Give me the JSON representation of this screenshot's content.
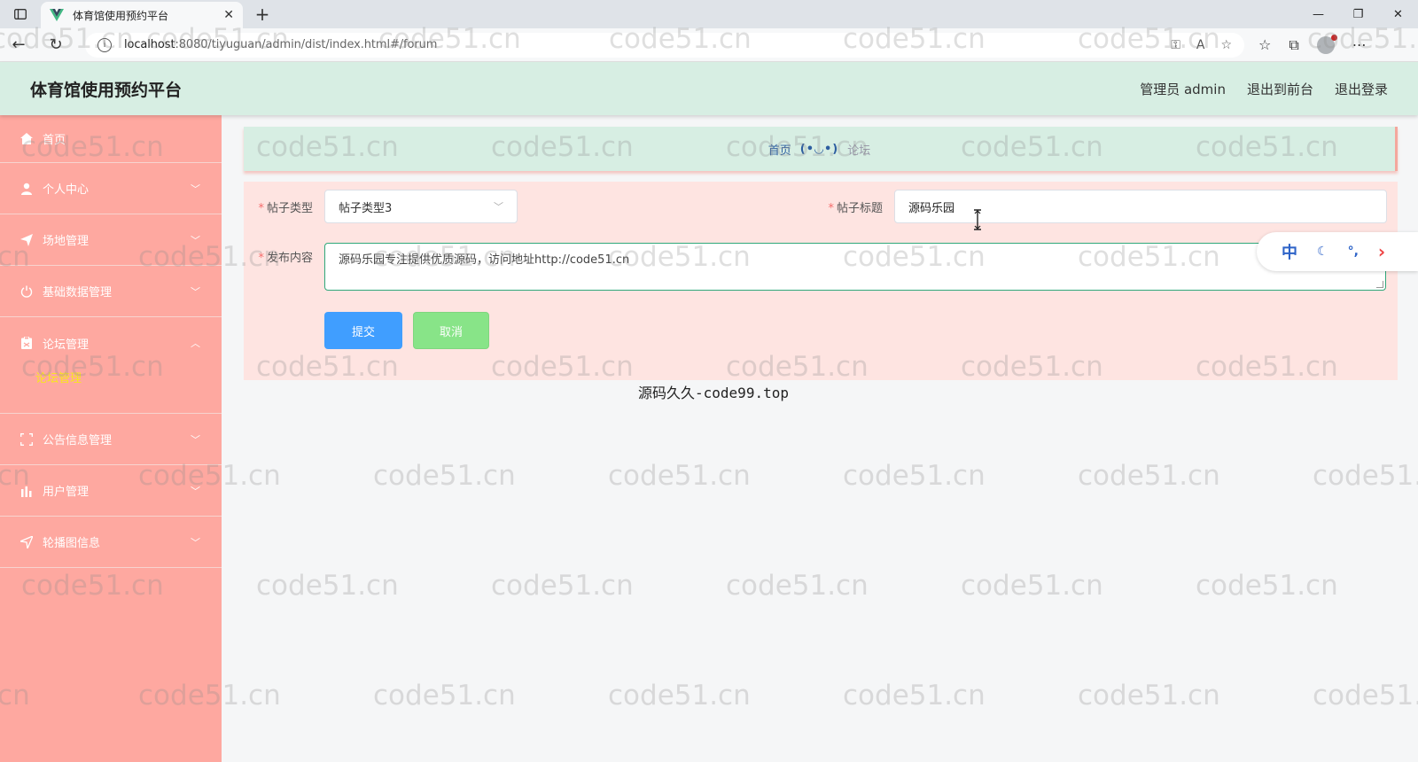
{
  "browser": {
    "tab_title": "体育馆使用预约平台",
    "url_host": "localhost",
    "url_rest": ":8080/tiyuguan/admin/dist/index.html#/forum",
    "icons": [
      "sidebar-toggle-icon",
      "vue-logo-icon",
      "close-icon",
      "plus-icon",
      "minimize-icon",
      "restore-icon",
      "window-close-icon",
      "back-arrow-icon",
      "refresh-icon",
      "info-icon",
      "key-icon",
      "read-aloud-icon",
      "favorite-add-icon",
      "favorites-icon",
      "collections-icon",
      "profile-icon",
      "more-icon"
    ]
  },
  "header": {
    "title": "体育馆使用预约平台",
    "admin_label": "管理员 admin",
    "to_front_label": "退出到前台",
    "logout_label": "退出登录"
  },
  "sidebar": {
    "items": [
      {
        "label": "首页",
        "icon": "home-icon"
      },
      {
        "label": "个人中心",
        "icon": "user-icon"
      },
      {
        "label": "场地管理",
        "icon": "send-icon"
      },
      {
        "label": "基础数据管理",
        "icon": "power-icon"
      },
      {
        "label": "论坛管理",
        "icon": "clipboard-icon",
        "sub": "论坛管理"
      },
      {
        "label": "公告信息管理",
        "icon": "frame-icon"
      },
      {
        "label": "用户管理",
        "icon": "bar-chart-icon"
      },
      {
        "label": "轮播图信息",
        "icon": "navigate-icon"
      }
    ]
  },
  "breadcrumb": {
    "home": "首页",
    "separator": "(•◡•)",
    "current": "论坛"
  },
  "form": {
    "type_label": "帖子类型",
    "type_value": "帖子类型3",
    "title_label": "帖子标题",
    "title_value": "源码乐园",
    "content_label": "发布内容",
    "content_value": "源码乐园专注提供优质源码，访问地址http://code51.cn",
    "submit_label": "提交",
    "cancel_label": "取消"
  },
  "ime": {
    "mode": "中"
  },
  "footer_note": "源码久久-code99.top",
  "watermark": "code51.cn",
  "colors": {
    "header_bg": "#d7eee3",
    "sidebar_bg": "#fea8a0",
    "panel_bg": "#fee4e1",
    "submit_bg": "#409eff",
    "cancel_bg": "#88e488",
    "submenu_active": "#f8e71c"
  }
}
